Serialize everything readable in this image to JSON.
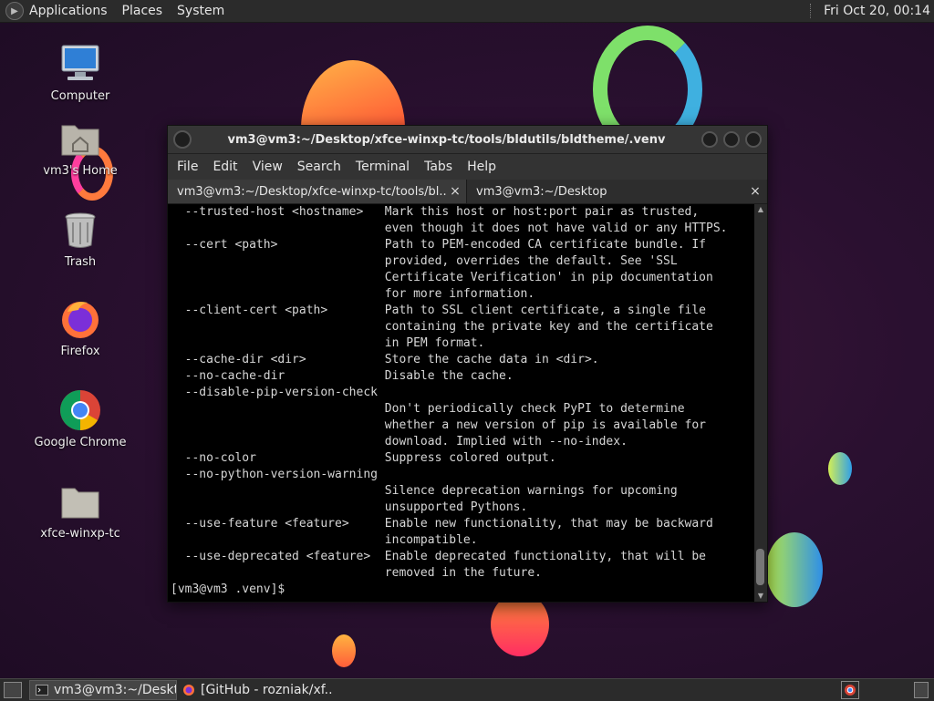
{
  "top_panel": {
    "menus": [
      "Applications",
      "Places",
      "System"
    ],
    "clock": "Fri Oct 20, 00:14"
  },
  "desktop_icons": [
    {
      "label": "Computer",
      "icon": "computer-icon"
    },
    {
      "label": "vm3's Home",
      "icon": "home-folder-icon"
    },
    {
      "label": "Trash",
      "icon": "trash-icon"
    },
    {
      "label": "Firefox",
      "icon": "firefox-icon"
    },
    {
      "label": "Google Chrome",
      "icon": "chrome-icon"
    },
    {
      "label": "xfce-winxp-tc",
      "icon": "folder-icon"
    }
  ],
  "window": {
    "title": "vm3@vm3:~/Desktop/xfce-winxp-tc/tools/bldutils/bldtheme/.venv",
    "menu": [
      "File",
      "Edit",
      "View",
      "Search",
      "Terminal",
      "Tabs",
      "Help"
    ],
    "tabs": [
      {
        "label": "vm3@vm3:~/Desktop/xfce-winxp-tc/tools/bl...",
        "close": "×"
      },
      {
        "label": "vm3@vm3:~/Desktop",
        "close": "×"
      }
    ]
  },
  "terminal_lines": [
    "  --trusted-host <hostname>   Mark this host or host:port pair as trusted,",
    "                              even though it does not have valid or any HTTPS.",
    "  --cert <path>               Path to PEM-encoded CA certificate bundle. If",
    "                              provided, overrides the default. See 'SSL",
    "                              Certificate Verification' in pip documentation",
    "                              for more information.",
    "  --client-cert <path>        Path to SSL client certificate, a single file",
    "                              containing the private key and the certificate",
    "                              in PEM format.",
    "  --cache-dir <dir>           Store the cache data in <dir>.",
    "  --no-cache-dir              Disable the cache.",
    "  --disable-pip-version-check",
    "                              Don't periodically check PyPI to determine",
    "                              whether a new version of pip is available for",
    "                              download. Implied with --no-index.",
    "  --no-color                  Suppress colored output.",
    "  --no-python-version-warning",
    "                              Silence deprecation warnings for upcoming",
    "                              unsupported Pythons.",
    "  --use-feature <feature>     Enable new functionality, that may be backward",
    "                              incompatible.",
    "  --use-deprecated <feature>  Enable deprecated functionality, that will be",
    "                              removed in the future.",
    "[vm3@vm3 .venv]$"
  ],
  "taskbar": {
    "tasks": [
      "vm3@vm3:~/Deskt...",
      "[GitHub - rozniak/xf..."
    ]
  },
  "colors": {
    "panel": "#2b2b2b",
    "terminal_bg": "#000000",
    "terminal_fg": "#d6d6d6"
  }
}
